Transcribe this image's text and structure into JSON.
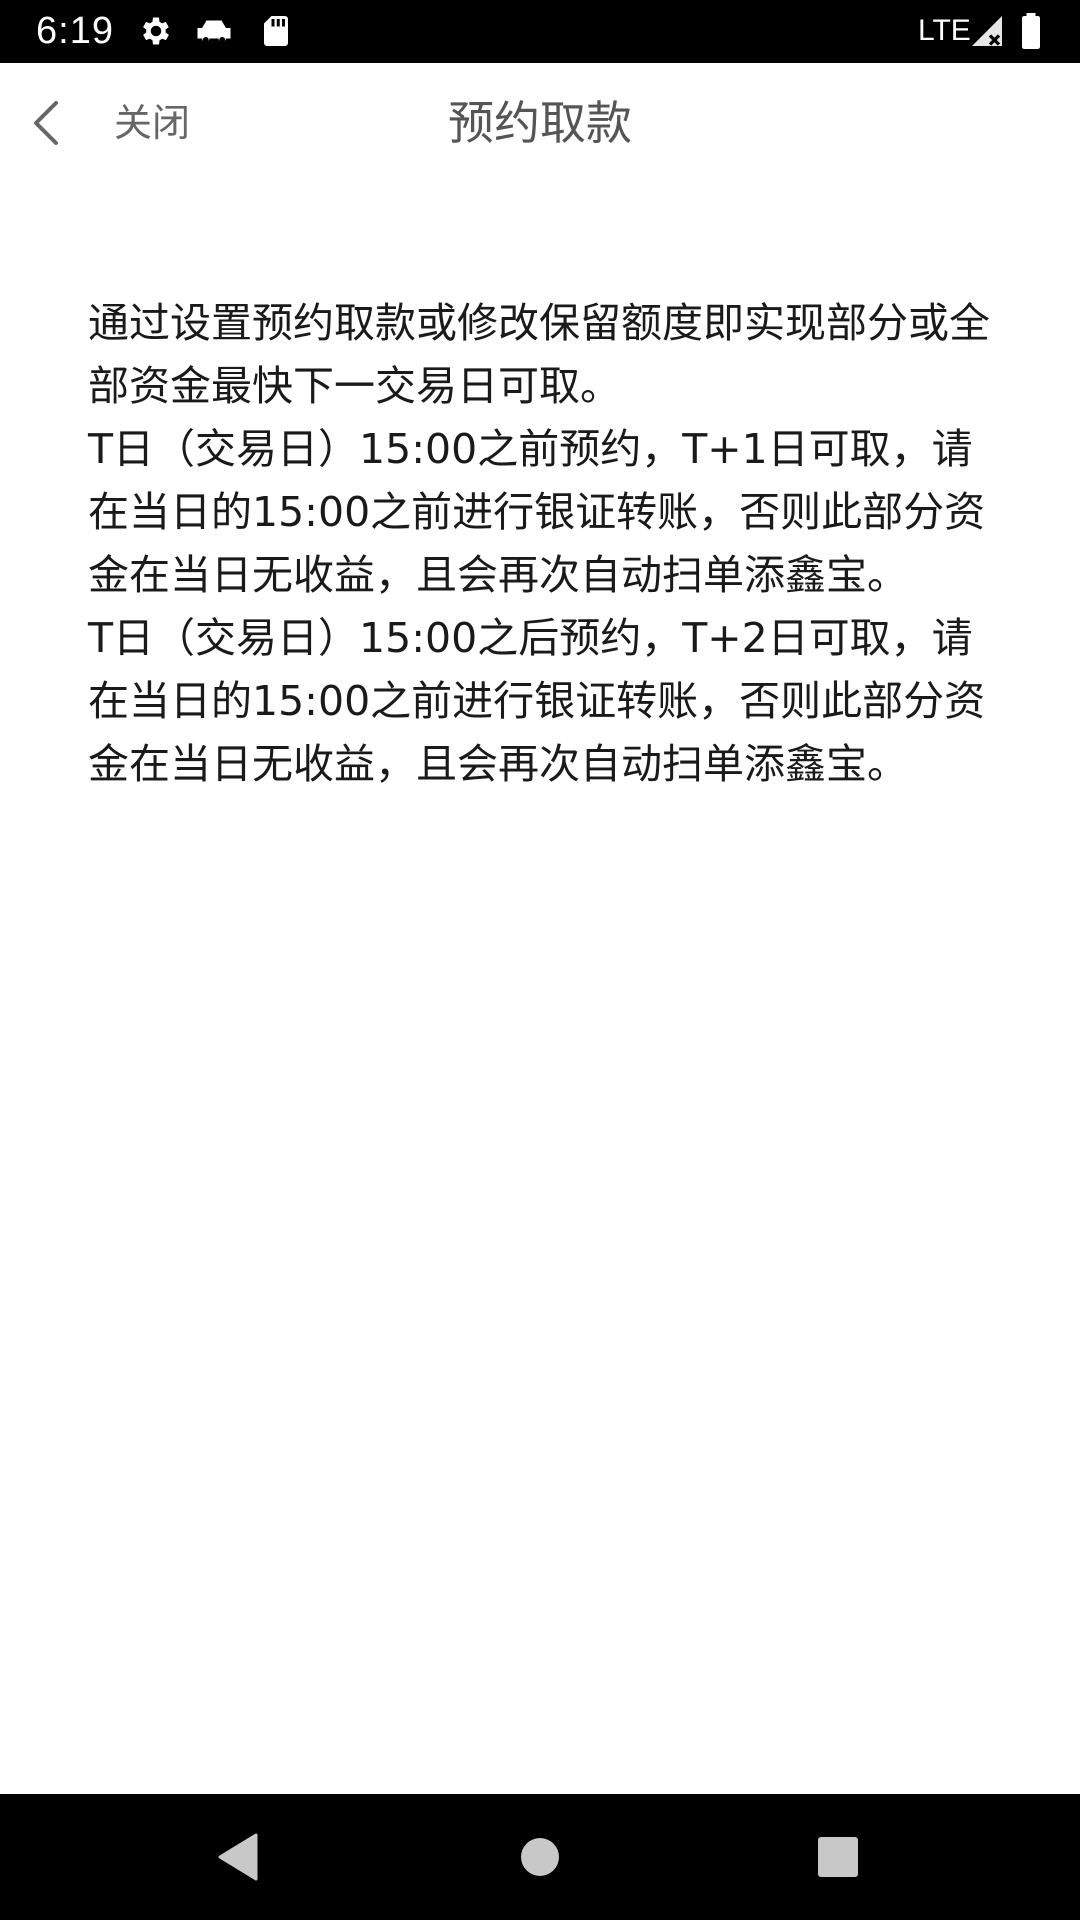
{
  "status_bar": {
    "time": "6:19",
    "network": "LTE",
    "icons": [
      "settings-icon",
      "cloud-sync-icon",
      "sd-card-icon",
      "signal-icon",
      "battery-icon"
    ]
  },
  "title_bar": {
    "close_label": "关闭",
    "title": "预约取款",
    "back_icon": "chevron-left-icon"
  },
  "content": {
    "paragraphs": [
      "通过设置预约取款或修改保留额度即实现部分或全部资金最快下一交易日可取。",
      "T日（交易日）15:00之前预约，T+1日可取，请在当日的15:00之前进行银证转账，否则此部分资金在当日无收益，且会再次自动扫单添鑫宝。",
      "T日（交易日）15:00之后预约，T+2日可取，请在当日的15:00之前进行银证转账，否则此部分资金在当日无收益，且会再次自动扫单添鑫宝。"
    ]
  },
  "nav_bar": {
    "icons": [
      "nav-back-icon",
      "nav-home-icon",
      "nav-recents-icon"
    ]
  },
  "colors": {
    "status_bar_bg": "#000000",
    "nav_bar_bg": "#000000",
    "title_text": "#555555",
    "close_text": "#666666",
    "body_text": "#1a1a1a",
    "nav_icon": "#c8c8c8"
  }
}
